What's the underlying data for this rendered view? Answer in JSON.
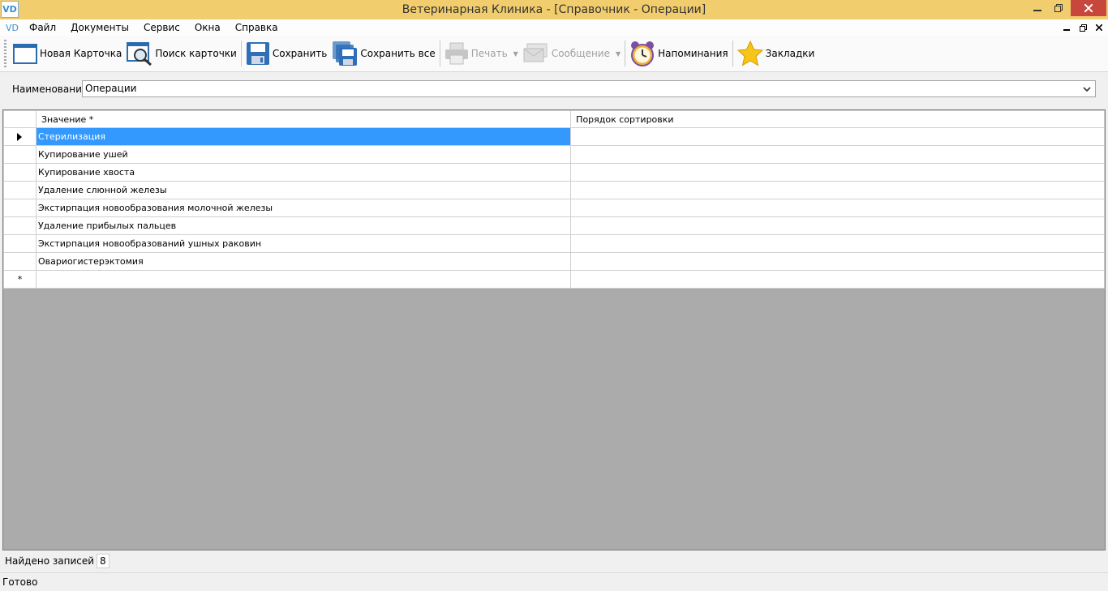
{
  "window": {
    "logo": "VD",
    "title": "Ветеринарная Клиника - [Справочник - Операции]"
  },
  "menu": {
    "logo": "VD",
    "items": [
      "Файл",
      "Документы",
      "Сервис",
      "Окна",
      "Справка"
    ]
  },
  "toolbar": {
    "new_card": "Новая Карточка",
    "search_card": "Поиск карточки",
    "save": "Сохранить",
    "save_all": "Сохранить все",
    "print": "Печать",
    "message": "Сообщение",
    "reminders": "Напоминания",
    "bookmarks": "Закладки"
  },
  "filter": {
    "label": "Наименование",
    "selected": "Операции"
  },
  "grid": {
    "columns": [
      "Значение *",
      "Порядок сортировки"
    ],
    "rows": [
      {
        "value": "Стерилизация",
        "sort": ""
      },
      {
        "value": "Купирование ушей",
        "sort": ""
      },
      {
        "value": "Купирование хвоста",
        "sort": ""
      },
      {
        "value": "Удаление слюнной железы",
        "sort": ""
      },
      {
        "value": "Экстирпация новообразования молочной железы",
        "sort": ""
      },
      {
        "value": "Удаление прибылых пальцев",
        "sort": ""
      },
      {
        "value": "Экстирпация новообразований ушных раковин",
        "sort": ""
      },
      {
        "value": "Овариогистерэктомия",
        "sort": ""
      }
    ],
    "new_row_marker": "*"
  },
  "found": {
    "label": "Найдено записей",
    "count": "8"
  },
  "status": {
    "text": "Готово"
  },
  "colors": {
    "titlebar": "#f1cd6e",
    "close": "#c7473d",
    "selection": "#3399ff",
    "grid_background": "#ababab"
  }
}
